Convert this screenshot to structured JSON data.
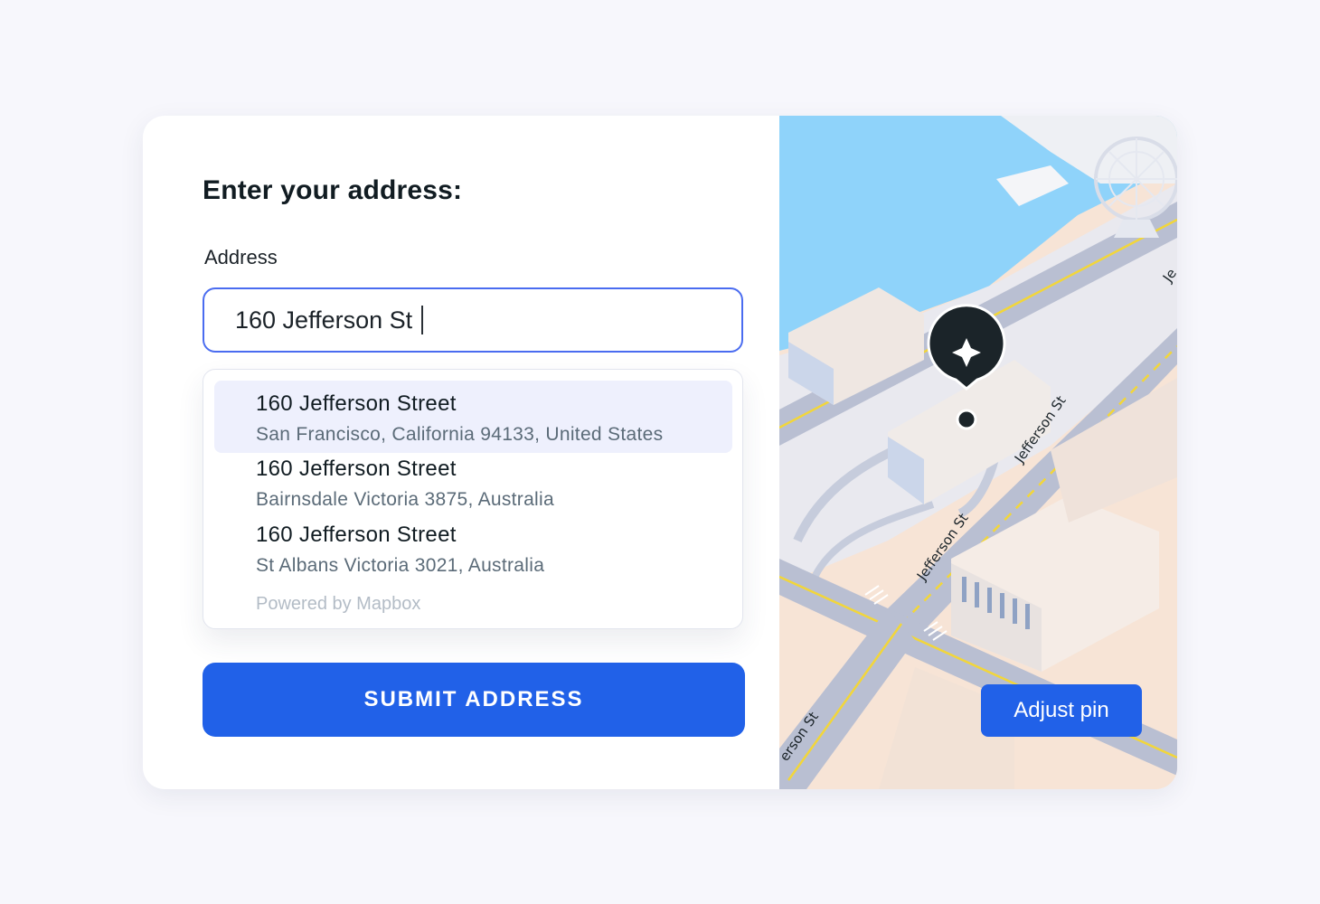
{
  "form": {
    "heading": "Enter your address:",
    "address_label": "Address",
    "address_value": "160 Jefferson St",
    "suggestions": [
      {
        "title": "160 Jefferson Street",
        "subtitle": "San Francisco, California 94133, United States"
      },
      {
        "title": "160 Jefferson Street",
        "subtitle": "Bairnsdale Victoria 3875, Australia"
      },
      {
        "title": "160 Jefferson Street",
        "subtitle": "St Albans Victoria 3021, Australia"
      }
    ],
    "powered_by": "Powered by Mapbox",
    "submit_label": "SUBMIT ADDRESS"
  },
  "map": {
    "street_labels": [
      "Jefferson St",
      "Jefferson St",
      "erson St",
      "Je"
    ],
    "adjust_pin_label": "Adjust pin",
    "marker_icon": "sparkle-icon"
  },
  "colors": {
    "accent": "#2161e8",
    "input_border": "#4a6cf0",
    "highlight": "#eef0fd",
    "water": "#8fd3fa",
    "land": "#f7e4d6",
    "road": "#b9bfd2",
    "road_line": "#f2d63a",
    "marker": "#1b2429"
  }
}
